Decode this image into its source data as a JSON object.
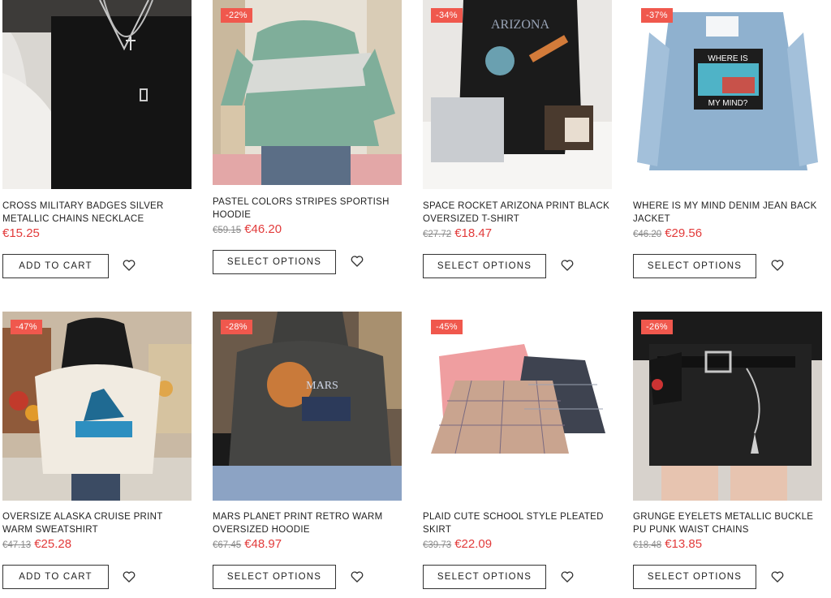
{
  "products": [
    {
      "title": "CROSS MILITARY BADGES SILVER METALLIC CHAINS NECKLACE",
      "badge": "",
      "old_price": "",
      "price": "€15.25",
      "button": "ADD TO CART"
    },
    {
      "title": "PASTEL COLORS STRIPES SPORTISH HOODIE",
      "badge": "-22%",
      "old_price": "€59.15",
      "price": "€46.20",
      "button": "SELECT OPTIONS"
    },
    {
      "title": "SPACE ROCKET ARIZONA PRINT BLACK OVERSIZED T-SHIRT",
      "badge": "-34%",
      "old_price": "€27.72",
      "price": "€18.47",
      "button": "SELECT OPTIONS"
    },
    {
      "title": "WHERE IS MY MIND DENIM JEAN BACK JACKET",
      "badge": "-37%",
      "old_price": "€46.20",
      "price": "€29.56",
      "button": "SELECT OPTIONS"
    },
    {
      "title": "OVERSIZE ALASKA CRUISE PRINT WARM SWEATSHIRT",
      "badge": "-47%",
      "old_price": "€47.13",
      "price": "€25.28",
      "button": "ADD TO CART"
    },
    {
      "title": "MARS PLANET PRINT RETRO WARM OVERSIZED HOODIE",
      "badge": "-28%",
      "old_price": "€67.45",
      "price": "€48.97",
      "button": "SELECT OPTIONS"
    },
    {
      "title": "PLAID CUTE SCHOOL STYLE PLEATED SKIRT",
      "badge": "-45%",
      "old_price": "€39.73",
      "price": "€22.09",
      "button": "SELECT OPTIONS"
    },
    {
      "title": "GRUNGE EYELETS METALLIC BUCKLE PU PUNK WAIST CHAINS",
      "badge": "-26%",
      "old_price": "€18.48",
      "price": "€13.85",
      "button": "SELECT OPTIONS"
    }
  ],
  "print_text": {
    "arizona": "ARIZONA",
    "where_is": "WHERE IS",
    "my_mind": "MY MIND?",
    "mars": "MARS"
  },
  "colors": {
    "badge": "#f0584d",
    "sale_price": "#e23b3b",
    "old_price": "#8a8a8a"
  }
}
